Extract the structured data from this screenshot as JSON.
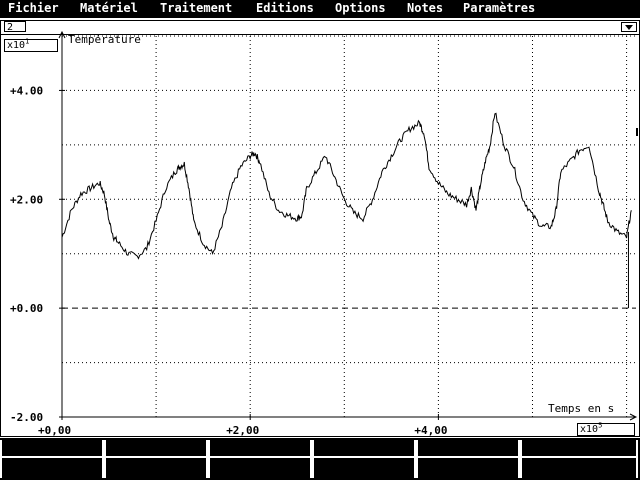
{
  "menu": [
    {
      "label": "Fichier"
    },
    {
      "label": "Matériel"
    },
    {
      "label": "Traitement"
    },
    {
      "label": "Editions"
    },
    {
      "label": "Options"
    },
    {
      "label": "Notes"
    },
    {
      "label": "Paramètres"
    }
  ],
  "window": {
    "number": "2"
  },
  "chart_data": {
    "type": "line",
    "ylabel": "Température",
    "xlabel": "Temps en s",
    "y_multiplier": "x10",
    "y_multiplier_exp": "1",
    "x_multiplier": "x10",
    "x_multiplier_exp": "5",
    "ylim": [
      -2.0,
      5.0
    ],
    "xlim": [
      0,
      6.1
    ],
    "y_ticks": [
      "+4.00",
      "+2.00",
      "+0.00",
      "-2.00"
    ],
    "y_tick_values": [
      4,
      2,
      0,
      -2
    ],
    "x_ticks": [
      "+0,00",
      "+2,00",
      "+4,00"
    ],
    "x_tick_values": [
      0,
      2,
      4
    ],
    "grid": true,
    "zero_line": "dashed",
    "series": [
      {
        "x": [
          0,
          0.1,
          0.2,
          0.3,
          0.4,
          0.45,
          0.5,
          0.55,
          0.6,
          0.7,
          0.8,
          0.9,
          1.0,
          1.1,
          1.2,
          1.25,
          1.3,
          1.35,
          1.4,
          1.5,
          1.6,
          1.7,
          1.8,
          1.9,
          2.0,
          2.05,
          2.1,
          2.2,
          2.3,
          2.4,
          2.5,
          2.55,
          2.6,
          2.7,
          2.8,
          2.9,
          3.0,
          3.1,
          3.2,
          3.3,
          3.4,
          3.5,
          3.6,
          3.7,
          3.8,
          3.85,
          3.9,
          4.0,
          4.1,
          4.2,
          4.3,
          4.35,
          4.4,
          4.45,
          4.5,
          4.55,
          4.6,
          4.7,
          4.8,
          4.9,
          5.0,
          5.1,
          5.2,
          5.25,
          5.3,
          5.4,
          5.5,
          5.6,
          5.7,
          5.75,
          5.8,
          5.9,
          6.0,
          6.05
        ],
        "values": [
          1.3,
          1.8,
          2.1,
          2.2,
          2.3,
          2.1,
          1.6,
          1.3,
          1.2,
          1.0,
          0.95,
          1.1,
          1.6,
          2.2,
          2.5,
          2.6,
          2.65,
          2.2,
          1.6,
          1.2,
          1.0,
          1.5,
          2.2,
          2.6,
          2.8,
          2.85,
          2.7,
          2.1,
          1.8,
          1.7,
          1.65,
          1.7,
          2.2,
          2.5,
          2.8,
          2.4,
          2.0,
          1.75,
          1.65,
          2.0,
          2.5,
          2.8,
          3.1,
          3.3,
          3.4,
          3.2,
          2.6,
          2.3,
          2.1,
          2.0,
          1.9,
          2.2,
          1.8,
          2.3,
          2.7,
          3.0,
          3.6,
          3.0,
          2.6,
          2.0,
          1.7,
          1.5,
          1.5,
          1.8,
          2.5,
          2.7,
          2.9,
          3.0,
          2.2,
          1.9,
          1.6,
          1.4,
          1.3,
          1.8
        ]
      }
    ]
  }
}
